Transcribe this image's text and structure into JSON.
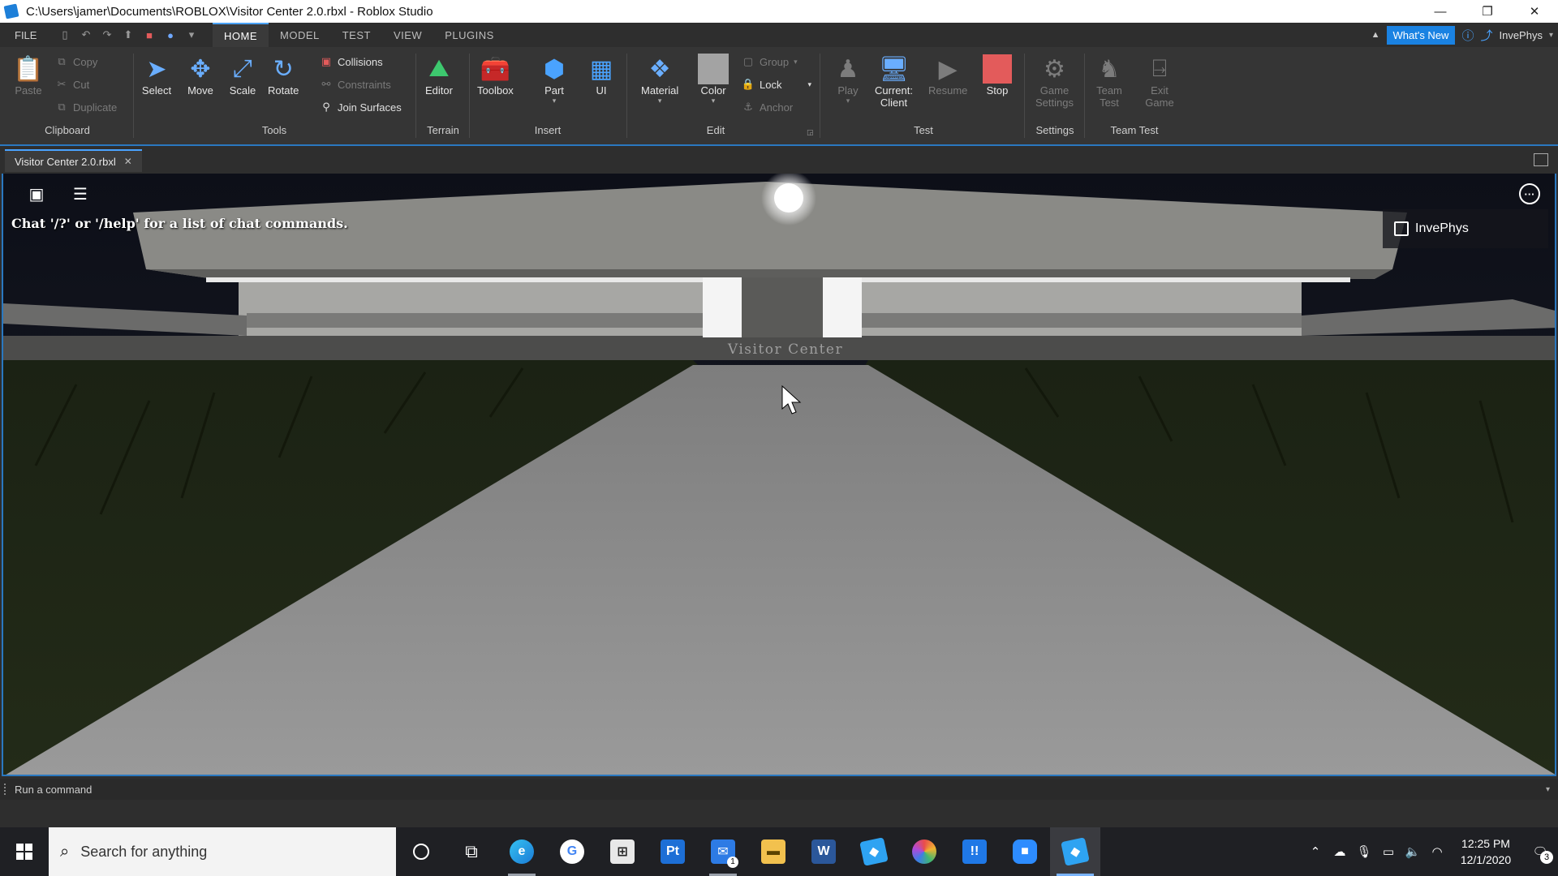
{
  "window": {
    "title": "C:\\Users\\jamer\\Documents\\ROBLOX\\Visitor Center 2.0.rbxl - Roblox Studio",
    "minimize": "—",
    "restore": "❐",
    "close": "✕"
  },
  "menu": {
    "file": "FILE",
    "tabs": [
      {
        "label": "HOME",
        "active": true
      },
      {
        "label": "MODEL"
      },
      {
        "label": "TEST"
      },
      {
        "label": "VIEW"
      },
      {
        "label": "PLUGINS"
      }
    ],
    "whats_new": "What's New",
    "user": "InvePhys"
  },
  "ribbon": {
    "clipboard": {
      "paste": "Paste",
      "copy": "Copy",
      "cut": "Cut",
      "duplicate": "Duplicate",
      "label": "Clipboard"
    },
    "tools": {
      "select": "Select",
      "move": "Move",
      "scale": "Scale",
      "rotate": "Rotate",
      "collisions": "Collisions",
      "constraints": "Constraints",
      "join_surfaces": "Join Surfaces",
      "label": "Tools"
    },
    "terrain": {
      "editor": "Editor",
      "label": "Terrain"
    },
    "insert": {
      "toolbox": "Toolbox",
      "part": "Part",
      "ui": "UI",
      "label": "Insert"
    },
    "edit": {
      "material": "Material",
      "color": "Color",
      "group": "Group",
      "lock": "Lock",
      "anchor": "Anchor",
      "label": "Edit"
    },
    "test": {
      "play": "Play",
      "current_client": "Current:",
      "current_client2": "Client",
      "resume": "Resume",
      "stop": "Stop",
      "label": "Test"
    },
    "settings": {
      "game_settings": "Game",
      "game_settings2": "Settings",
      "label": "Settings"
    },
    "team_test": {
      "team_test": "Team",
      "team_test2": "Test",
      "exit_game": "Exit",
      "exit_game2": "Game",
      "label": "Team Test"
    }
  },
  "document": {
    "tab": "Visitor Center 2.0.rbxl",
    "close": "✕"
  },
  "viewport": {
    "chat_hint": "Chat '/?' or '/help' for a list of chat commands.",
    "sign": "Visitor Center",
    "user_panel": "InvePhys",
    "more": "···"
  },
  "command_bar": {
    "placeholder": "Run a command"
  },
  "taskbar": {
    "search_placeholder": "Search for anything",
    "time": "12:25 PM",
    "date": "12/1/2020",
    "notifications": "3",
    "mail_badge": "1"
  },
  "colors": {
    "accent": "#1a82e2",
    "ribbon_bg": "#353535",
    "stop_red": "#e35b5b",
    "taskbar_bg": "#1f2024"
  }
}
